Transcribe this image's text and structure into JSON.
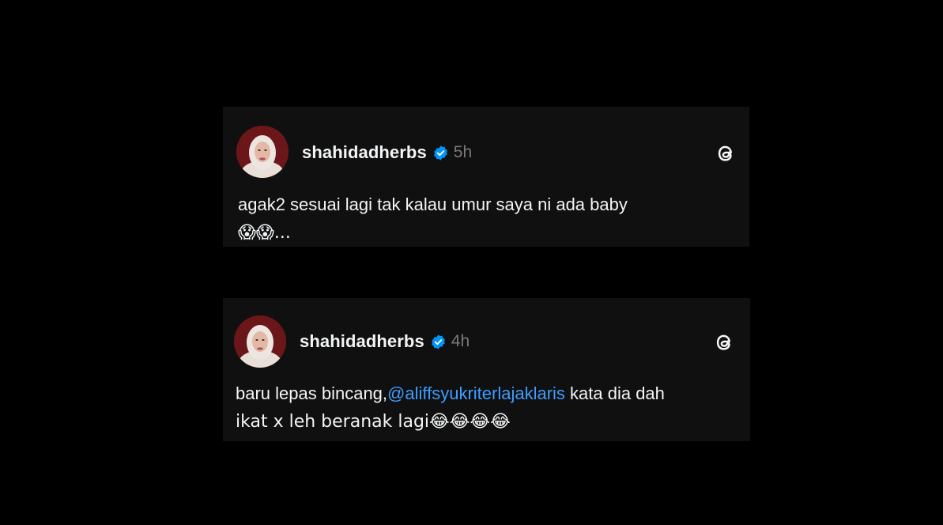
{
  "posts": [
    {
      "username": "shahidadherbs",
      "timestamp": "5h",
      "text_line_1": "agak2 sesuai lagi tak kalau umur saya ni ada baby",
      "text_line_2": "😱😱...",
      "avatar_icon": "profile-photo",
      "verified_icon": "verified-badge-icon",
      "app_icon": "threads-logo-icon"
    },
    {
      "username": "shahidadherbs",
      "timestamp": "4h",
      "text_line_1_prefix": "baru lepas bincang,",
      "mention": "@aliffsyukriterlajaklaris",
      "text_line_1_suffix": " kata dia dah",
      "text_line_2": "ikat x leh beranak lagi😂😂😂😂",
      "avatar_icon": "profile-photo",
      "verified_icon": "verified-badge-icon",
      "app_icon": "threads-logo-icon"
    }
  ],
  "colors": {
    "background": "#000000",
    "card": "#101010",
    "text": "#f3f5f7",
    "muted": "#7a7a7a",
    "mention": "#3f9dff",
    "verified": "#0095f6"
  }
}
